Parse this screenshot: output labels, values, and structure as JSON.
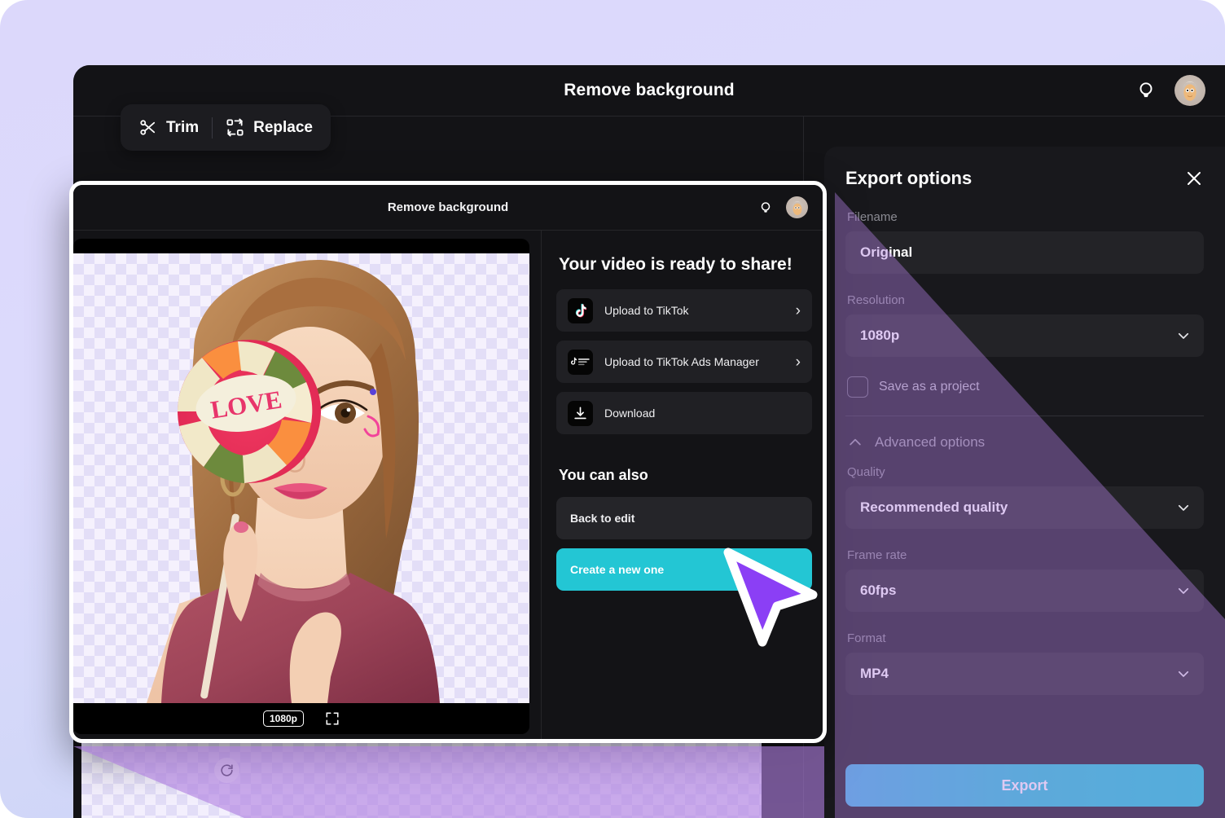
{
  "app": {
    "window_title": "Remove background",
    "toolbar": {
      "trim_label": "Trim",
      "replace_label": "Replace",
      "trim_icon": "scissors-icon",
      "replace_icon": "replace-icon"
    },
    "topbar_icons": {
      "bulb": "lightbulb-icon",
      "avatar": "user-avatar"
    }
  },
  "modal": {
    "title": "Remove background",
    "player": {
      "resolution_badge": "1080p",
      "fullscreen_icon": "fullscreen-icon"
    },
    "share": {
      "heading": "Your video is ready to share!",
      "options": [
        {
          "label": "Upload to TikTok",
          "icon": "tiktok-icon",
          "chevron": "›"
        },
        {
          "label": "Upload to TikTok Ads Manager",
          "icon": "tiktok-ads-icon",
          "chevron": "›"
        },
        {
          "label": "Download",
          "icon": "download-icon",
          "chevron": ""
        }
      ],
      "also_heading": "You can also",
      "alt_actions": [
        {
          "label": "Back to edit",
          "primary": false
        },
        {
          "label": "Create a new one",
          "primary": true
        }
      ]
    }
  },
  "export_panel": {
    "title": "Export options",
    "close_icon": "close-icon",
    "fields": [
      {
        "label": "Filename",
        "value": "Original",
        "has_caret": false
      },
      {
        "label": "Resolution",
        "value": "1080p",
        "has_caret": true
      }
    ],
    "checkbox": {
      "label": "Save as a project",
      "checked": false
    },
    "advanced": {
      "label": "Advanced options",
      "expanded": true,
      "chevron_icon": "chevron-up-icon",
      "fields": [
        {
          "label": "Quality",
          "value": "Recommended quality",
          "has_caret": true
        },
        {
          "label": "Frame rate",
          "value": "60fps",
          "has_caret": true
        },
        {
          "label": "Format",
          "value": "MP4",
          "has_caret": true
        }
      ]
    },
    "export_button": "Export"
  },
  "colors": {
    "accent_teal": "#23c6d4",
    "cursor_purple": "#8b3ff5",
    "overlay_purple": "#b07fe0",
    "panel_bg": "#18181c",
    "window_bg": "#131316"
  }
}
